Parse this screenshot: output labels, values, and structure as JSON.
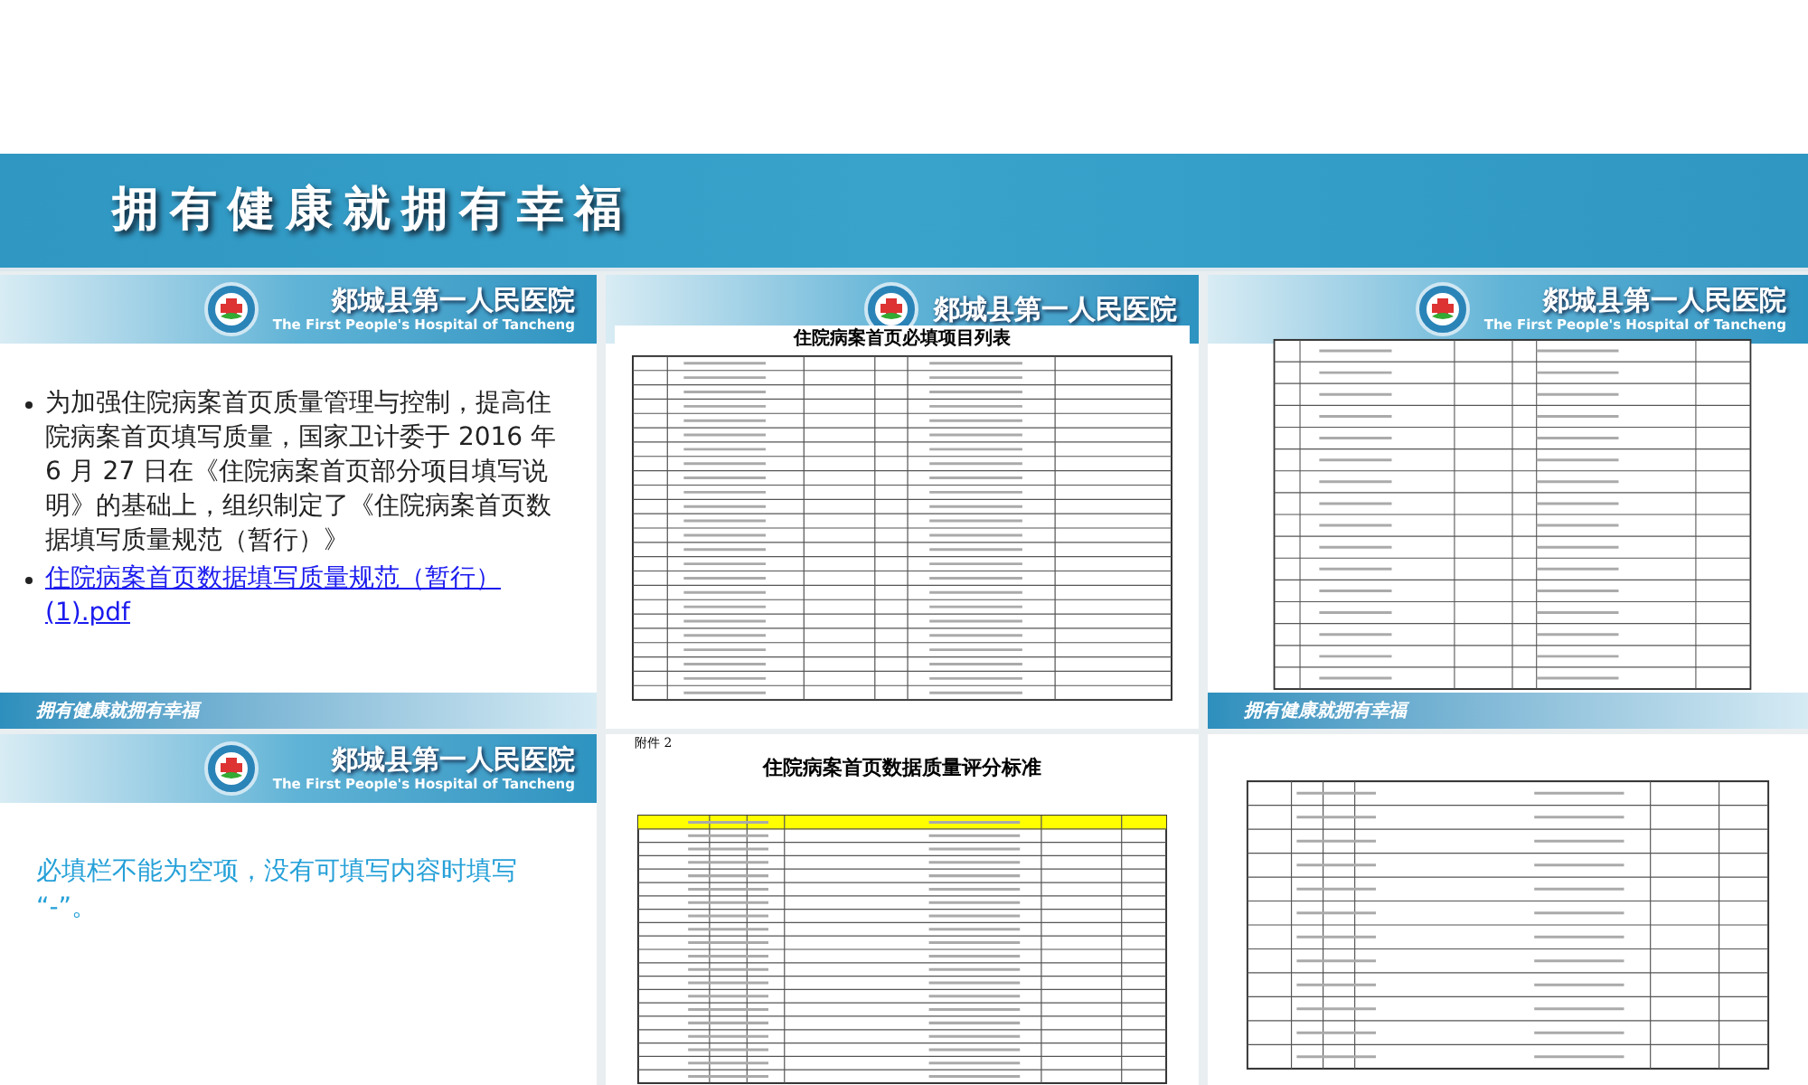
{
  "banner": {
    "title": "拥有健康就拥有幸福"
  },
  "slides": [
    {
      "kind": "bullets",
      "hospital_name": "郯城县第一人民医院",
      "hospital_name_en": "The First People's Hospital of Tancheng",
      "bullets": [
        {
          "text": "为加强住院病案首页质量管理与控制，提高住院病案首页填写质量，国家卫计委于 2016 年 6 月 27 日在《住院病案首页部分项目填写说明》的基础上，组织制定了《住院病案首页数据填写质量规范（暂行）》",
          "link": false
        },
        {
          "text": "住院病案首页数据填写质量规范（暂行）(1).pdf",
          "link": true
        }
      ],
      "footer": "拥有健康就拥有幸福"
    },
    {
      "kind": "document",
      "hospital_name": "郯城县第一人民医院",
      "doc_title": "住院病案首页必填项目列表"
    },
    {
      "kind": "table",
      "hospital_name": "郯城县第一人民医院",
      "hospital_name_en": "The First People's Hospital of Tancheng",
      "footer": "拥有健康就拥有幸福"
    },
    {
      "kind": "note",
      "hospital_name": "郯城县第一人民医院",
      "hospital_name_en": "The First People's Hospital of Tancheng",
      "text": "必填栏不能为空项，没有可填写内容时填写 “-”。"
    },
    {
      "kind": "document",
      "doc_label": "附件 2",
      "doc_title": "住院病案首页数据质量评分标准"
    },
    {
      "kind": "scan"
    }
  ]
}
